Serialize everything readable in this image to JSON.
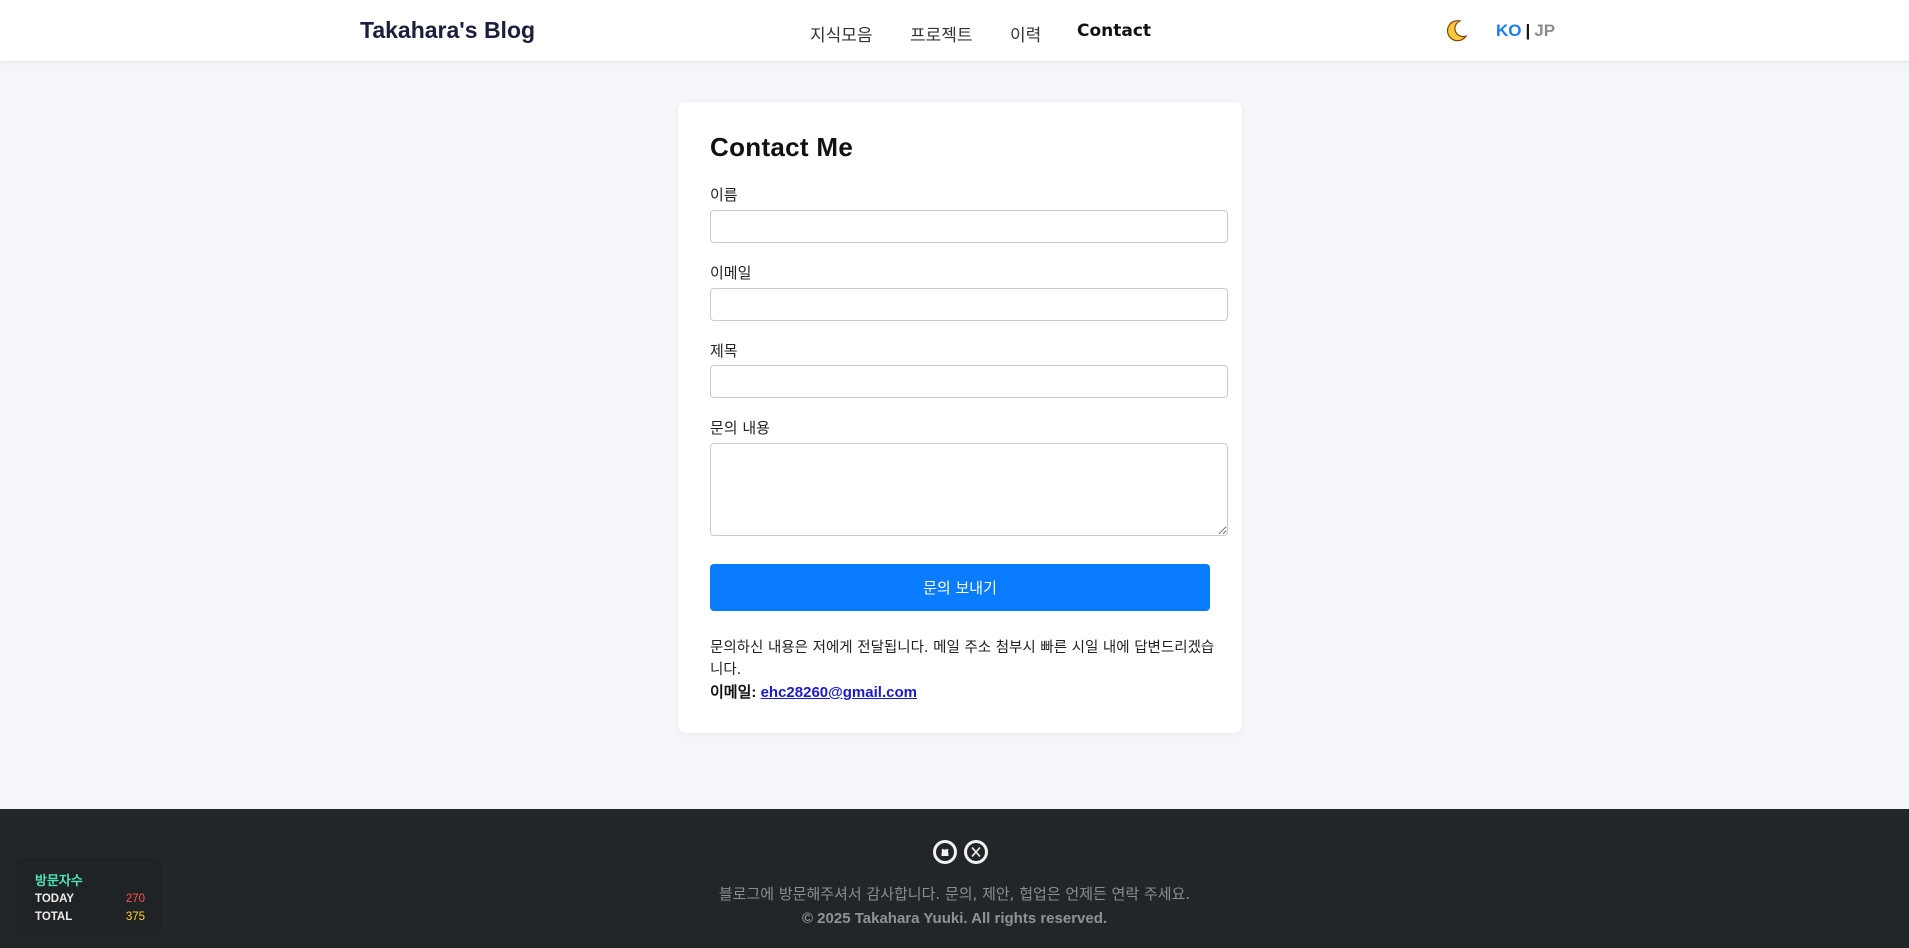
{
  "header": {
    "brand": "Takahara's Blog",
    "nav": [
      "지식모음",
      "프로젝트",
      "이력",
      "Contact"
    ],
    "active_nav": "Contact",
    "theme_icon": "moon-icon",
    "lang_ko": "KO",
    "lang_sep": "|",
    "lang_jp": "JP"
  },
  "form": {
    "title": "Contact Me",
    "name_label": "이름",
    "name_value": "",
    "email_label": "이메일",
    "email_value": "",
    "subject_label": "제목",
    "subject_value": "",
    "message_label": "문의 내용",
    "message_value": "",
    "submit_label": "문의 보내기",
    "note": "문의하신 내용은 저에게 전달됩니다. 메일 주소 첨부시 빠른 시일 내에 답변드리겠습니다.",
    "email_prefix": "이메일:",
    "email_link": "ehc28260@gmail.com"
  },
  "footer": {
    "social_icons": [
      "github-icon",
      "x-icon"
    ],
    "message": "블로그에 방문해주셔서 감사합니다. 문의, 제안, 협업은 언제든 연락 주세요.",
    "copyright": "© 2025 Takahara Yuuki. All rights reserved."
  },
  "visitor": {
    "title": "방문자수",
    "today_label": "TODAY",
    "today_value": "270",
    "total_label": "TOTAL",
    "total_value": "375",
    "today_color": "#ff5252",
    "total_color": "#ffd12b"
  },
  "colors": {
    "accent": "#0a7cff",
    "lang_active": "#1d7cf2",
    "footer_bg": "#232629"
  }
}
